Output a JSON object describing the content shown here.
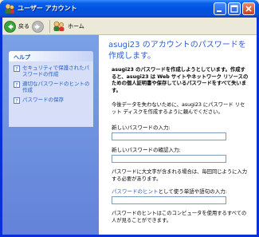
{
  "window": {
    "title": "ユーザー アカウント"
  },
  "toolbar": {
    "back_label": "戻る",
    "home_label": "ホーム"
  },
  "help": {
    "heading": "ヘルプ",
    "items": [
      {
        "label": "セキュリティで保護されたパスワードの作成"
      },
      {
        "label": "適切なパスワードのヒントの作成"
      },
      {
        "label": "パスワードの保存"
      }
    ]
  },
  "main": {
    "heading": "asugi23 のアカウントのパスワードを作成します。",
    "warning_text": "asugi23 のパスワードを作成しようとしています。作成すると、asugi23 は Web サイトやネットワーク リソースのための個人証明書や保存しているパスワードをすべて失います。",
    "backup_text": "今後データを失わないために、asugi23 にパスワード リセット ディスクを作成するように頼んでください。",
    "new_password_label": "新しいパスワードの入力:",
    "confirm_password_label": "新しいパスワードの確認入力:",
    "case_note": "パスワードに大文字が含まれる場合は、毎回同じように入力する必要があります。",
    "hint_link": "パスワードのヒント",
    "hint_label_rest": "として使う単語や語句の入力:",
    "hint_note": "パスワードのヒントはこのコンピュータを使用するすべての人が見ることができます。",
    "new_password_value": "",
    "confirm_password_value": "",
    "hint_value": ""
  },
  "colors": {
    "title_bar": "#0053e1",
    "link": "#2d5fc9",
    "sidepane": "#7aa1e6"
  },
  "icons": {
    "app": "user-accounts-icon",
    "back": "back-arrow-icon",
    "forward": "forward-arrow-icon",
    "home": "home-users-icon",
    "help_item": "help-page-icon"
  }
}
